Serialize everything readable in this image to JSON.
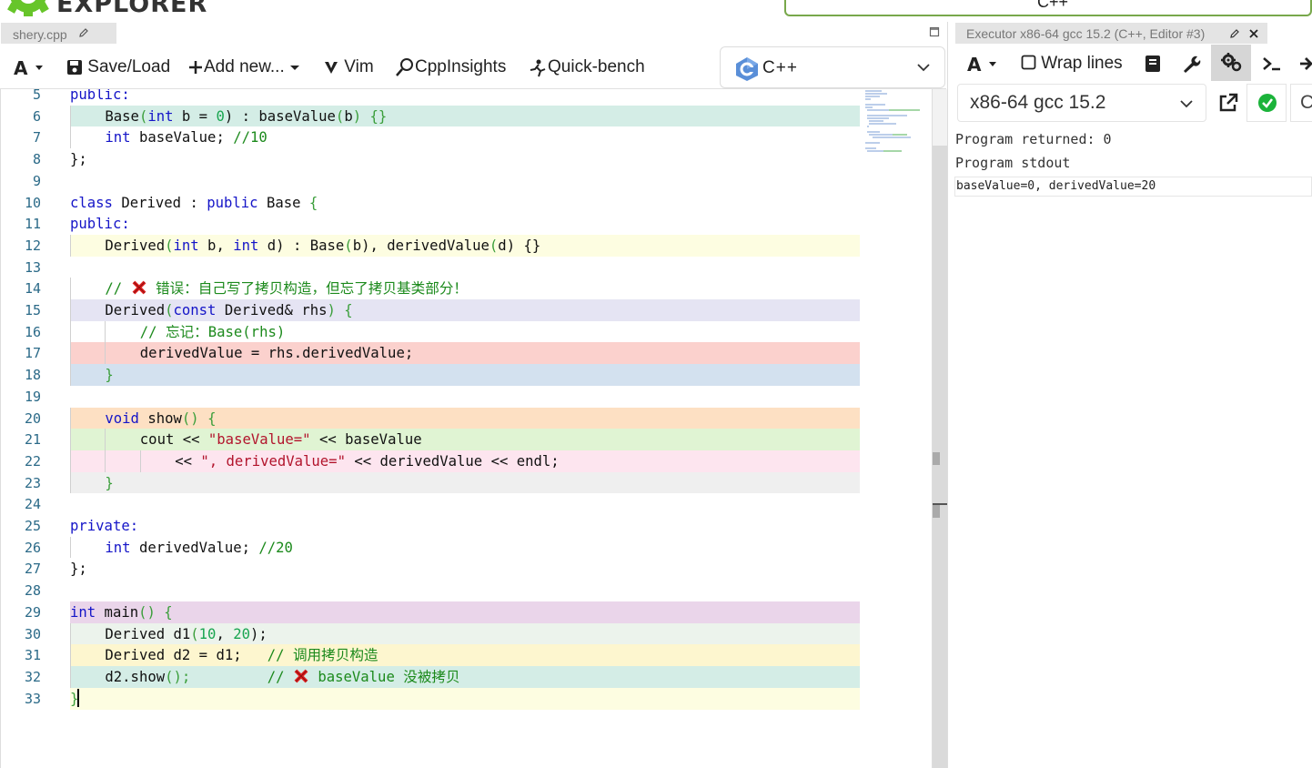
{
  "brand": {
    "name": "EXPLORER"
  },
  "language_top": "C++",
  "editor": {
    "tab_title": "shery.cpp",
    "toolbar": {
      "save_load": "Save/Load",
      "add_new": "Add new...",
      "vim": "Vim",
      "cppinsights": "CppInsights",
      "quick_bench": "Quick-bench",
      "language": "C++"
    },
    "lines": [
      {
        "n": "5",
        "bg": "#ffffff"
      },
      {
        "n": "6",
        "bg": "#d4ede6"
      },
      {
        "n": "7",
        "bg": "#ffffff"
      },
      {
        "n": "8",
        "bg": "#ffffff"
      },
      {
        "n": "9",
        "bg": "#ffffff"
      },
      {
        "n": "10",
        "bg": "#ffffff"
      },
      {
        "n": "11",
        "bg": "#ffffff"
      },
      {
        "n": "12",
        "bg": "#fdfde1"
      },
      {
        "n": "13",
        "bg": "#ffffff"
      },
      {
        "n": "14",
        "bg": "#ffffff"
      },
      {
        "n": "15",
        "bg": "#e5e4f3"
      },
      {
        "n": "16",
        "bg": "#ffffff"
      },
      {
        "n": "17",
        "bg": "#fbd1cd"
      },
      {
        "n": "18",
        "bg": "#d3e1ef"
      },
      {
        "n": "19",
        "bg": "#ffffff"
      },
      {
        "n": "20",
        "bg": "#fde0c3"
      },
      {
        "n": "21",
        "bg": "#e0f4d3"
      },
      {
        "n": "22",
        "bg": "#fde5ef"
      },
      {
        "n": "23",
        "bg": "#efefef"
      },
      {
        "n": "24",
        "bg": "#ffffff"
      },
      {
        "n": "25",
        "bg": "#ffffff"
      },
      {
        "n": "26",
        "bg": "#ffffff"
      },
      {
        "n": "27",
        "bg": "#ffffff"
      },
      {
        "n": "28",
        "bg": "#ffffff"
      },
      {
        "n": "29",
        "bg": "#ead5ea"
      },
      {
        "n": "30",
        "bg": "#ecf3ec"
      },
      {
        "n": "31",
        "bg": "#fdf6cf"
      },
      {
        "n": "32",
        "bg": "#d4ede6"
      },
      {
        "n": "33",
        "bg": "#fdfde1"
      }
    ],
    "code": {
      "l5": "public:",
      "l6": [
        "Base",
        "(",
        "int",
        " b = ",
        "0",
        ") : baseValue",
        "(",
        "b",
        ") {}"
      ],
      "l7": [
        "int",
        " baseValue; ",
        "//10"
      ],
      "l8": "};",
      "l10": [
        "class",
        " Derived : ",
        "public",
        " Base ",
        "{"
      ],
      "l11": "public:",
      "l12": [
        "Derived",
        "(",
        "int",
        " b, ",
        "int",
        " d) : Base",
        "(",
        "b",
        "), derivedValue",
        "(",
        "d",
        ") {}"
      ],
      "l14_pre": "// ",
      "l14_post": " 错误：自己写了拷贝构造，但忘了拷贝基类部分！",
      "l15": [
        "Derived",
        "(",
        "const",
        " Derived& rhs",
        ")",
        " {"
      ],
      "l16": "// 忘记：Base(rhs)",
      "l17": "derivedValue = rhs.derivedValue;",
      "l18": "}",
      "l20": [
        "void",
        " show",
        "()",
        " {"
      ],
      "l21": [
        "cout << ",
        "\"baseValue=\"",
        " << baseValue"
      ],
      "l22": [
        "<< ",
        "\", derivedValue=\"",
        " << derivedValue << endl;"
      ],
      "l23": "}",
      "l25": "private:",
      "l26": [
        "int",
        " derivedValue; ",
        "//20"
      ],
      "l27": "};",
      "l29": [
        "int",
        " main",
        "()",
        " {"
      ],
      "l30": [
        "Derived d1",
        "(",
        "10",
        ", ",
        "20",
        ");"
      ],
      "l31": [
        "Derived d2 = d1;   ",
        "// 调用拷贝构造"
      ],
      "l32_pre": [
        "d2.show",
        "();",
        "         // "
      ],
      "l32_post": " baseValue 没被拷贝",
      "l33": "}"
    }
  },
  "executor": {
    "tab_title": "Executor x86-64 gcc 15.2 (C++, Editor #3)",
    "wrap_lines": "Wrap lines",
    "compiler": "x86-64 gcc 15.2",
    "program_returned": "Program returned: 0",
    "program_stdout_label": "Program stdout",
    "stdout": "baseValue=0, derivedValue=20"
  },
  "colors": {
    "accent_green": "#67c52a",
    "error_red": "#e02020",
    "keyword": "#1515c8"
  },
  "icons": [
    "gear-logo-icon",
    "pencil-icon",
    "maximize-icon",
    "font-icon",
    "save-icon",
    "plus-icon",
    "vim-icon",
    "cppinsights-icon",
    "quick-bench-icon",
    "cpp-logo-icon",
    "chevron-down-icon",
    "close-icon",
    "checkbox-icon",
    "book-icon",
    "wrench-icon",
    "gears-icon",
    "terminal-icon",
    "arrow-right-icon",
    "popout-icon",
    "check-circle-icon",
    "cross-mark-icon"
  ]
}
